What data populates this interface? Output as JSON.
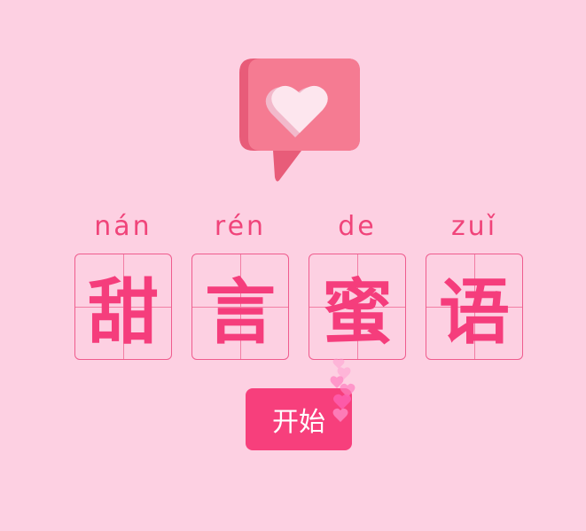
{
  "logo": {
    "icon": "heart-chat-bubble-icon",
    "colors": {
      "bubble": "#f57b92",
      "bubble_shadow": "#e85c79",
      "heart": "#fde6ee",
      "heart_shadow": "#f2b9cb"
    }
  },
  "title": {
    "pinyin": [
      "nán",
      "rén",
      "de",
      "zuǐ"
    ],
    "characters": [
      "甜",
      "言",
      "蜜",
      "语"
    ]
  },
  "start_button": {
    "label": "开始"
  },
  "decoration": {
    "icon": "floating-hearts-icon"
  },
  "colors": {
    "background": "#fdd0e2",
    "accent": "#f53d7c",
    "grid_line": "#ef5c8e"
  }
}
